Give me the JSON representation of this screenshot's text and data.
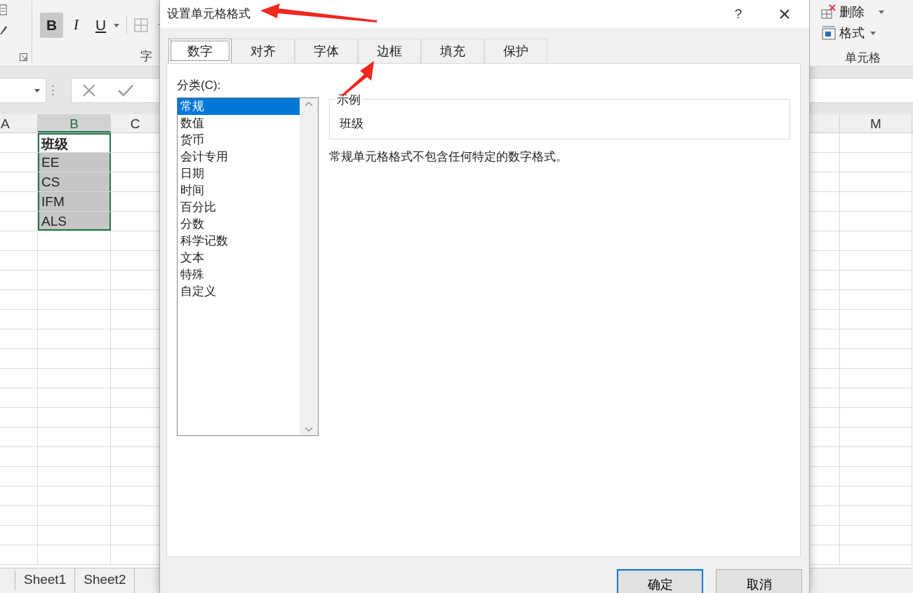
{
  "excel": {
    "format_buttons": [
      {
        "label": "B",
        "selected": true
      },
      {
        "label": "I",
        "selected": false
      },
      {
        "label": "U",
        "selected": false
      }
    ],
    "font_group_label": "字",
    "cells_group": {
      "items": [
        {
          "label": "删除",
          "kind": "delete"
        },
        {
          "label": "格式",
          "kind": "format"
        }
      ],
      "label": "单元格"
    },
    "column_headers": [
      {
        "label": "A",
        "selected": false
      },
      {
        "label": "B",
        "selected": true
      },
      {
        "label": "C",
        "selected": false
      }
    ],
    "right_column_headers": [
      {
        "selected": false
      },
      {
        "label": "M",
        "selected": false
      }
    ],
    "cells": [
      {
        "value": "班级",
        "bold": true,
        "selected": false
      },
      {
        "value": "EE",
        "bold": false,
        "selected": true
      },
      {
        "value": "CS",
        "bold": false,
        "selected": true
      },
      {
        "value": "IFM",
        "bold": false,
        "selected": true
      },
      {
        "value": "ALS",
        "bold": false,
        "selected": true
      }
    ],
    "sheet_tabs": [
      {
        "label": "Sheet1",
        "selected": false
      },
      {
        "label": "Sheet2",
        "selected": false
      }
    ]
  },
  "dialog": {
    "title": "设置单元格格式",
    "help": "?",
    "close": "×",
    "tabs": [
      {
        "label": "数字",
        "selected": true
      },
      {
        "label": "对齐",
        "selected": false
      },
      {
        "label": "字体",
        "selected": false
      },
      {
        "label": "边框",
        "selected": false
      },
      {
        "label": "填充",
        "selected": false
      },
      {
        "label": "保护",
        "selected": false
      }
    ],
    "category_label": "分类(C):",
    "categories": [
      {
        "label": "常规",
        "selected": true
      },
      {
        "label": "数值",
        "selected": false
      },
      {
        "label": "货币",
        "selected": false
      },
      {
        "label": "会计专用",
        "selected": false
      },
      {
        "label": "日期",
        "selected": false
      },
      {
        "label": "时间",
        "selected": false
      },
      {
        "label": "百分比",
        "selected": false
      },
      {
        "label": "分数",
        "selected": false
      },
      {
        "label": "科学记数",
        "selected": false
      },
      {
        "label": "文本",
        "selected": false
      },
      {
        "label": "特殊",
        "selected": false
      },
      {
        "label": "自定义",
        "selected": false
      }
    ],
    "sample_label": "示例",
    "sample_value": "班级",
    "description": "常规单元格格式不包含任何特定的数字格式。",
    "buttons": [
      {
        "label": "确定",
        "kind": "primary"
      },
      {
        "label": "取消",
        "kind": "default"
      }
    ]
  }
}
